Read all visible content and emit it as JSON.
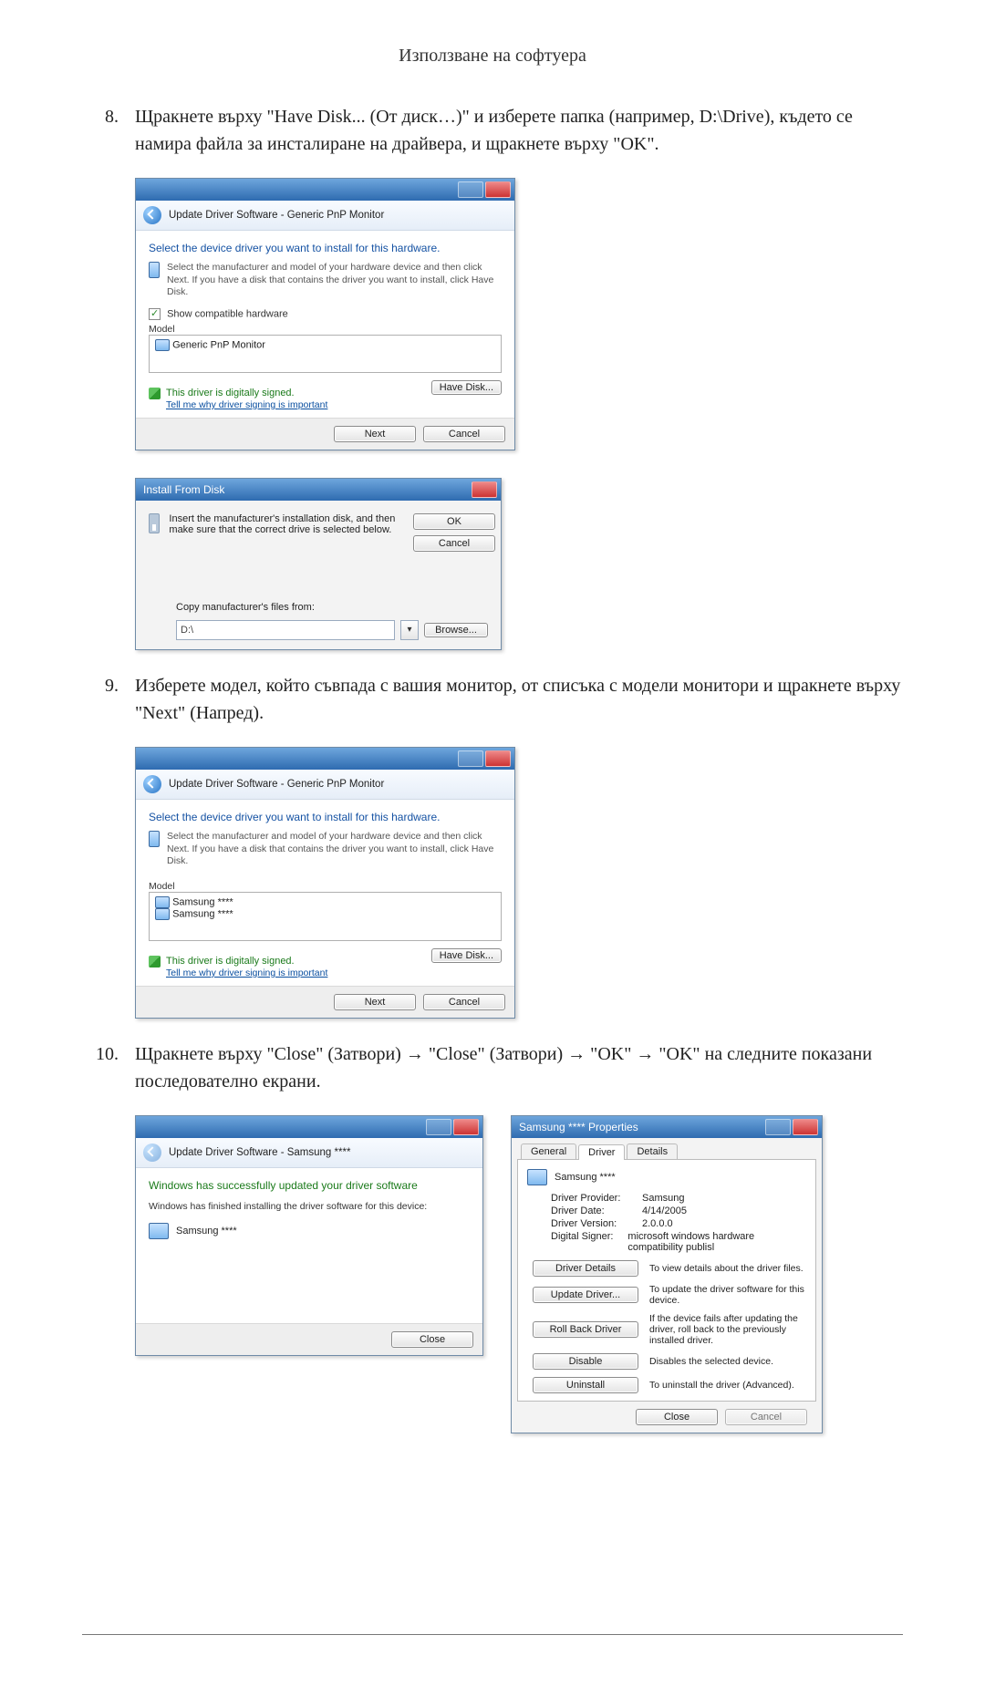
{
  "page_header": "Използване на софтуера",
  "steps": {
    "s8": {
      "num": "8.",
      "text": "Щракнете върху \"Have Disk... (От диск…)\" и изберете папка (например, D:\\Drive), където се намира файла за инсталиране на драйвера, и щракнете върху \"OK\"."
    },
    "s9": {
      "num": "9.",
      "text": "Изберете модел, който съвпада с вашия монитор, от списъка с модели монитори и щракнете върху \"Next\" (Напред)."
    },
    "s10": {
      "num": "10.",
      "text": "Щракнете върху \"Close\" (Затвори) → \"Close\" (Затвори) → \"OK\" → \"OK\" на следните показани последователно екрани."
    }
  },
  "dlg_update1": {
    "crumb": "Update Driver Software - Generic PnP Monitor",
    "instr": "Select the device driver you want to install for this hardware.",
    "hint": "Select the manufacturer and model of your hardware device and then click Next. If you have a disk that contains the driver you want to install, click Have Disk.",
    "show_compat": "Show compatible hardware",
    "model_label": "Model",
    "model_item": "Generic PnP Monitor",
    "signed": "This driver is digitally signed.",
    "tell_link": "Tell me why driver signing is important",
    "have_disk": "Have Disk...",
    "next": "Next",
    "cancel": "Cancel"
  },
  "dlg_ifd": {
    "title": "Install From Disk",
    "text": "Insert the manufacturer's installation disk, and then make sure that the correct drive is selected below.",
    "ok": "OK",
    "cancel": "Cancel",
    "copy_label": "Copy manufacturer's files from:",
    "path": "D:\\",
    "browse": "Browse..."
  },
  "dlg_update2": {
    "crumb": "Update Driver Software - Generic PnP Monitor",
    "instr": "Select the device driver you want to install for this hardware.",
    "hint": "Select the manufacturer and model of your hardware device and then click Next. If you have a disk that contains the driver you want to install, click Have Disk.",
    "model_label": "Model",
    "model_item1": "Samsung ****",
    "model_item2": "Samsung ****",
    "signed": "This driver is digitally signed.",
    "tell_link": "Tell me why driver signing is important",
    "have_disk": "Have Disk...",
    "next": "Next",
    "cancel": "Cancel"
  },
  "dlg_done": {
    "crumb": "Update Driver Software - Samsung ****",
    "headline": "Windows has successfully updated your driver software",
    "sub": "Windows has finished installing the driver software for this device:",
    "device": "Samsung ****",
    "close": "Close"
  },
  "dlg_props": {
    "title": "Samsung **** Properties",
    "tabs": {
      "general": "General",
      "driver": "Driver",
      "details": "Details"
    },
    "device": "Samsung ****",
    "provider_lbl": "Driver Provider:",
    "provider": "Samsung",
    "date_lbl": "Driver Date:",
    "date": "4/14/2005",
    "version_lbl": "Driver Version:",
    "version": "2.0.0.0",
    "signer_lbl": "Digital Signer:",
    "signer": "microsoft windows hardware compatibility publisl",
    "btn_details": "Driver Details",
    "desc_details": "To view details about the driver files.",
    "btn_update": "Update Driver...",
    "desc_update": "To update the driver software for this device.",
    "btn_rollback": "Roll Back Driver",
    "desc_rollback": "If the device fails after updating the driver, roll back to the previously installed driver.",
    "btn_disable": "Disable",
    "desc_disable": "Disables the selected device.",
    "btn_uninstall": "Uninstall",
    "desc_uninstall": "To uninstall the driver (Advanced).",
    "close": "Close",
    "cancel": "Cancel"
  }
}
